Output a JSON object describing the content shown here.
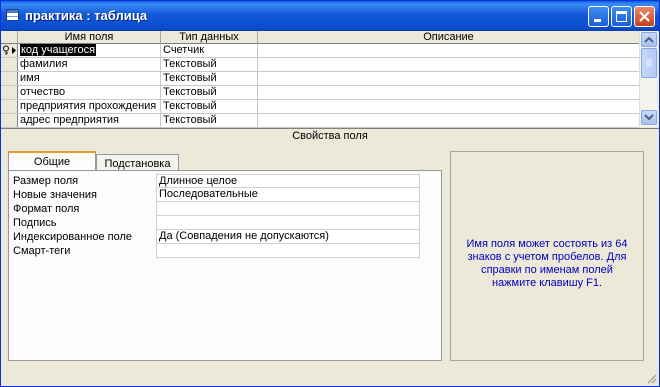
{
  "window": {
    "title": "практика : таблица"
  },
  "grid": {
    "columns": [
      "Имя поля",
      "Тип данных",
      "Описание"
    ],
    "rows": [
      {
        "name": "код учащегося",
        "type": "Счетчик",
        "desc": ""
      },
      {
        "name": "фамилия",
        "type": "Текстовый",
        "desc": ""
      },
      {
        "name": "имя",
        "type": "Текстовый",
        "desc": ""
      },
      {
        "name": "отчество",
        "type": "Текстовый",
        "desc": ""
      },
      {
        "name": "предприятия прохождения",
        "type": "Текстовый",
        "desc": ""
      },
      {
        "name": "адрес предприятия",
        "type": "Текстовый",
        "desc": ""
      }
    ]
  },
  "properties": {
    "section_title": "Свойства поля",
    "tabs": [
      "Общие",
      "Подстановка"
    ],
    "rows": [
      {
        "label": "Размер поля",
        "value": "Длинное целое"
      },
      {
        "label": "Новые значения",
        "value": "Последовательные"
      },
      {
        "label": "Формат поля",
        "value": ""
      },
      {
        "label": "Подпись",
        "value": ""
      },
      {
        "label": "Индексированное поле",
        "value": "Да (Совпадения не допускаются)"
      },
      {
        "label": "Смарт-теги",
        "value": ""
      }
    ]
  },
  "help": {
    "text": "Имя поля может состоять из 64 знаков с учетом пробелов.  Для справки по именам полей нажмите клавишу F1."
  },
  "colors": {
    "titlebar": "#0a4ccd",
    "help_text": "#0000c0",
    "active_tab_accent": "#e6a02a"
  }
}
